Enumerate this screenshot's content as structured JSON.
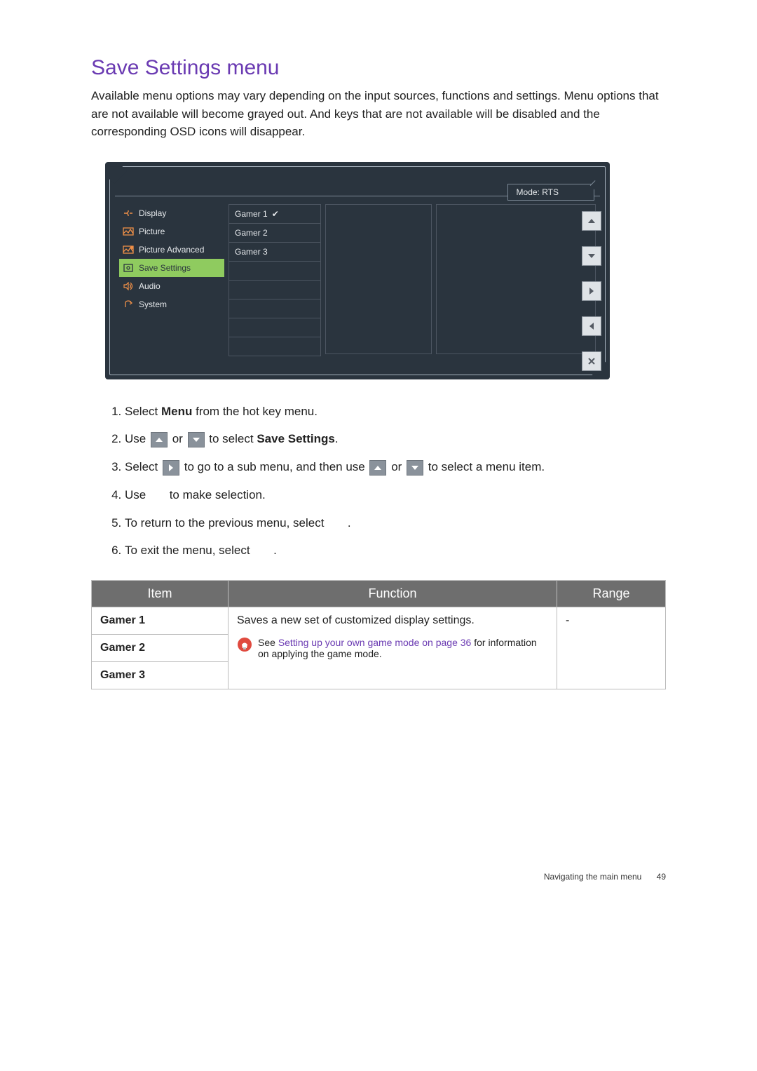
{
  "heading": "Save Settings menu",
  "intro": "Available menu options may vary depending on the input sources, functions and settings. Menu options that are not available will become grayed out. And keys that are not available will be disabled and the corresponding OSD icons will disappear.",
  "osd": {
    "mode_label": "Mode: RTS",
    "sidebar": [
      {
        "label": "Display",
        "active": false
      },
      {
        "label": "Picture",
        "active": false
      },
      {
        "label": "Picture Advanced",
        "active": false
      },
      {
        "label": "Save Settings",
        "active": true
      },
      {
        "label": "Audio",
        "active": false
      },
      {
        "label": "System",
        "active": false
      }
    ],
    "col1": [
      {
        "label": "Gamer 1",
        "checked": true
      },
      {
        "label": "Gamer 2",
        "checked": false
      },
      {
        "label": "Gamer 3",
        "checked": false
      }
    ]
  },
  "steps": {
    "s1a": "Select ",
    "s1b": "Menu",
    "s1c": " from the hot key menu.",
    "s2a": "Use ",
    "s2b": " or ",
    "s2c": " to select ",
    "s2d": "Save Settings",
    "s2e": ".",
    "s3a": "Select ",
    "s3b": " to go to a sub menu, and then use ",
    "s3c": " or ",
    "s3d": " to select a menu item.",
    "s4a": "Use ",
    "s4b": " to make selection.",
    "s5a": "To return to the previous menu, select ",
    "s5b": ".",
    "s6a": "To exit the menu, select ",
    "s6b": "."
  },
  "table": {
    "headers": {
      "item": "Item",
      "func": "Function",
      "range": "Range"
    },
    "rows": {
      "g1": "Gamer 1",
      "g2": "Gamer 2",
      "g3": "Gamer 3",
      "func_text": "Saves a new set of customized display settings.",
      "tip_pre": "See ",
      "tip_link": "Setting up your own game mode on page 36",
      "tip_post": " for information on applying the game mode.",
      "range": "-"
    }
  },
  "footer": {
    "section": "Navigating the main menu",
    "page": "49"
  }
}
